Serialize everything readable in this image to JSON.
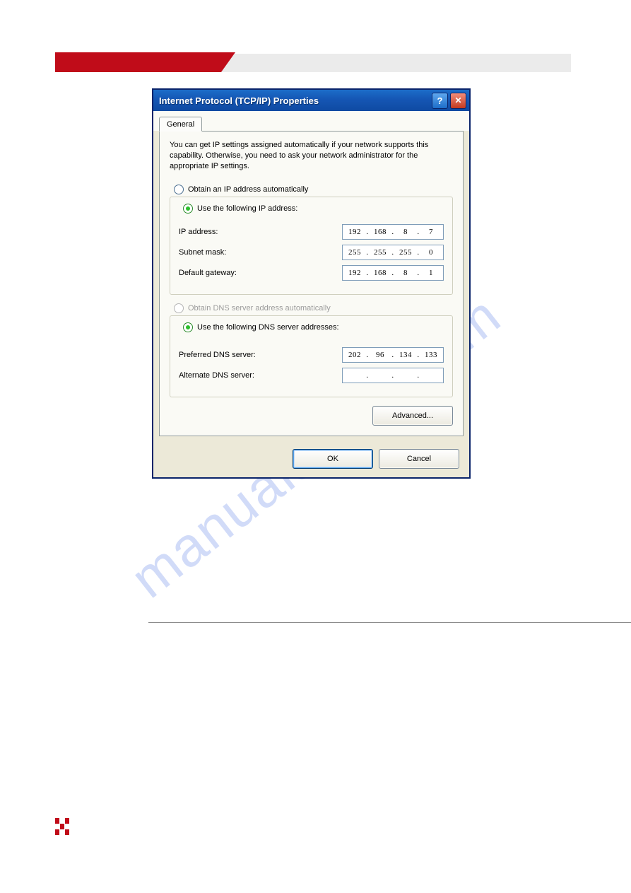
{
  "watermark": "manualshive.com",
  "dialog": {
    "title": "Internet Protocol (TCP/IP) Properties",
    "tab_general": "General",
    "intro": "You can get IP settings assigned automatically if your network supports this capability. Otherwise, you need to ask your network administrator for the appropriate IP settings.",
    "ip": {
      "radio_auto": "Obtain an IP address automatically",
      "radio_manual": "Use the following IP address:",
      "label_ip": "IP address:",
      "label_mask": "Subnet mask:",
      "label_gw": "Default gateway:",
      "val_ip": [
        "192",
        "168",
        "8",
        "7"
      ],
      "val_mask": [
        "255",
        "255",
        "255",
        "0"
      ],
      "val_gw": [
        "192",
        "168",
        "8",
        "1"
      ]
    },
    "dns": {
      "radio_auto": "Obtain DNS server address automatically",
      "radio_manual": "Use the following DNS server addresses:",
      "label_pref": "Preferred DNS server:",
      "label_alt": "Alternate DNS server:",
      "val_pref": [
        "202",
        "96",
        "134",
        "133"
      ],
      "val_alt": [
        "",
        "",
        "",
        ""
      ]
    },
    "btn_advanced": "Advanced...",
    "btn_ok": "OK",
    "btn_cancel": "Cancel",
    "help_glyph": "?",
    "close_glyph": "✕"
  }
}
